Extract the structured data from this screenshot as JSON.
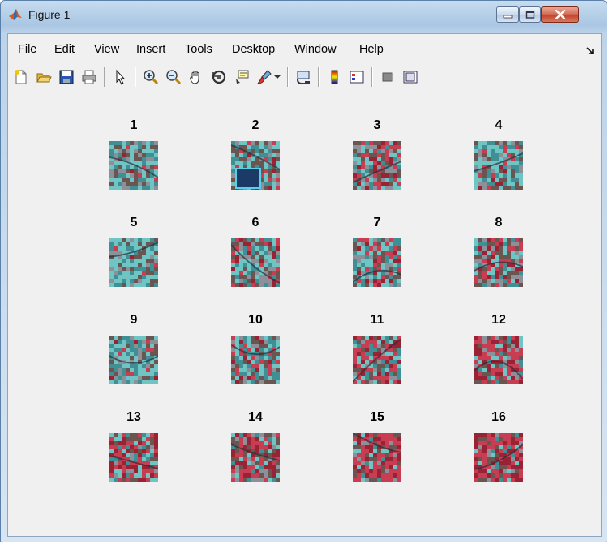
{
  "window": {
    "title": "Figure 1",
    "title_icon": "matlab-icon",
    "controls": [
      "minimize-icon",
      "maximize-icon",
      "close-icon"
    ]
  },
  "menu": {
    "items": [
      "File",
      "Edit",
      "View",
      "Insert",
      "Tools",
      "Desktop",
      "Window",
      "Help"
    ],
    "dock_arrow_icon": "dock-arrow-icon"
  },
  "toolbar": {
    "buttons": [
      "new-figure-icon",
      "open-file-icon",
      "save-icon",
      "print-icon",
      "edit-plot-arrow-icon",
      "zoom-in-icon",
      "zoom-out-icon",
      "pan-hand-icon",
      "rotate-3d-icon",
      "data-cursor-icon",
      "brush-icon",
      "brush-dropdown-icon",
      "link-plot-icon",
      "insert-colorbar-icon",
      "insert-legend-icon",
      "hide-plot-tools-icon",
      "show-plot-tools-icon"
    ]
  },
  "figure": {
    "subplot_titles": [
      "1",
      "2",
      "3",
      "4",
      "5",
      "6",
      "7",
      "8",
      "9",
      "10",
      "11",
      "12",
      "13",
      "14",
      "15",
      "16"
    ],
    "tile_palette": {
      "cyan": "#6fc4c4",
      "teal": "#3f8f94",
      "red": "#c93d52",
      "crimson": "#9a2235",
      "brown": "#6b5550",
      "grey": "#8c9098",
      "water": "#1b3a66"
    },
    "tile_mix": [
      {
        "cyan": 0.55,
        "red": 0.05,
        "brown": 0.4
      },
      {
        "cyan": 0.4,
        "red": 0.15,
        "brown": 0.45,
        "pool": true
      },
      {
        "cyan": 0.35,
        "red": 0.35,
        "brown": 0.3
      },
      {
        "cyan": 0.6,
        "red": 0.1,
        "brown": 0.3
      },
      {
        "cyan": 0.65,
        "red": 0.05,
        "brown": 0.3
      },
      {
        "cyan": 0.45,
        "red": 0.2,
        "brown": 0.35
      },
      {
        "cyan": 0.45,
        "red": 0.25,
        "brown": 0.3
      },
      {
        "cyan": 0.3,
        "red": 0.3,
        "brown": 0.4
      },
      {
        "cyan": 0.6,
        "red": 0.1,
        "brown": 0.3
      },
      {
        "cyan": 0.45,
        "red": 0.3,
        "brown": 0.25
      },
      {
        "cyan": 0.3,
        "red": 0.45,
        "brown": 0.25
      },
      {
        "cyan": 0.2,
        "red": 0.55,
        "brown": 0.25
      },
      {
        "cyan": 0.3,
        "red": 0.5,
        "brown": 0.2
      },
      {
        "cyan": 0.15,
        "red": 0.5,
        "brown": 0.35
      },
      {
        "cyan": 0.15,
        "red": 0.65,
        "brown": 0.2
      },
      {
        "cyan": 0.1,
        "red": 0.7,
        "brown": 0.2
      }
    ]
  }
}
